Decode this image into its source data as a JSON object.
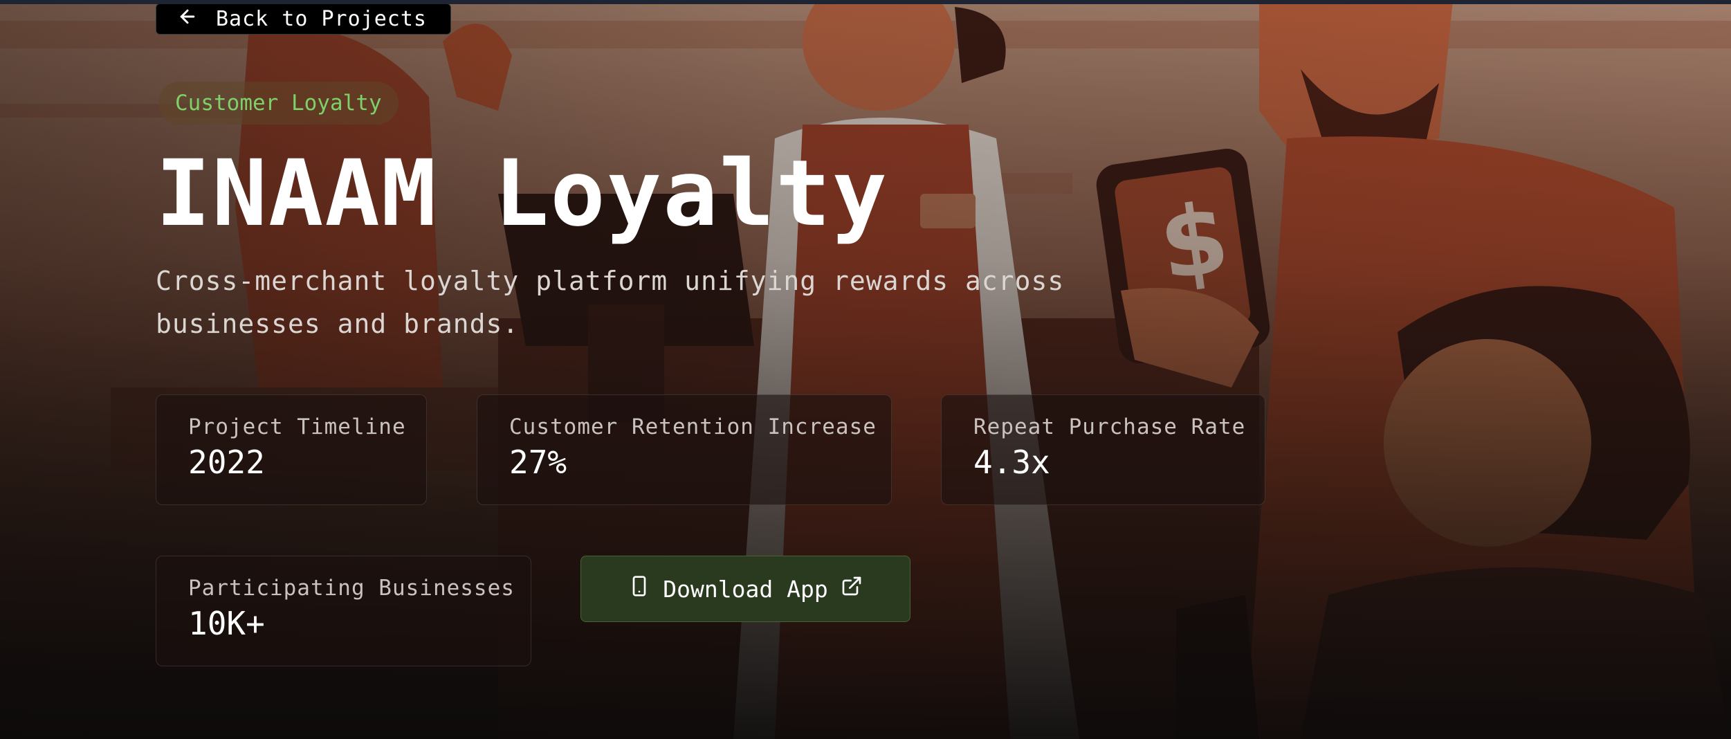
{
  "nav": {
    "back_label": "Back to Projects"
  },
  "hero": {
    "tag": "Customer Loyalty",
    "title": "INAAM Loyalty",
    "subtitle": "Cross-merchant loyalty platform unifying rewards across businesses and brands.",
    "image_description_icon": "illustration-store-staff-and-customers"
  },
  "stats": [
    {
      "label": "Project Timeline",
      "value": "2022"
    },
    {
      "label": "Customer Retention Increase",
      "value": "27%"
    },
    {
      "label": "Repeat Purchase Rate",
      "value": "4.3x"
    },
    {
      "label": "Participating Businesses",
      "value": "10K+"
    }
  ],
  "actions": {
    "download_label": "Download App",
    "download_icon": "smartphone-icon",
    "external_icon": "external-link-icon"
  },
  "colors": {
    "accent_green": "#7ed06a",
    "button_green": "#2a3a1e",
    "hero_terracotta": "#a84a2c"
  }
}
